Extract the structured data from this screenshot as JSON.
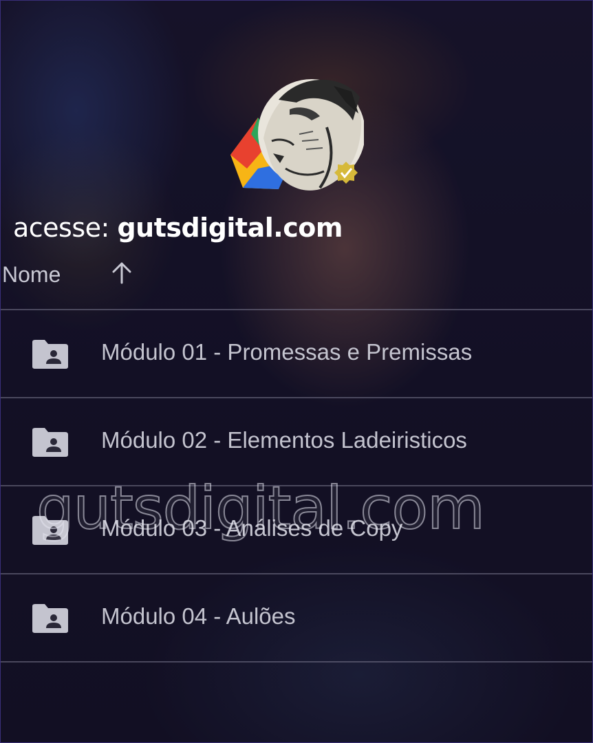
{
  "branding": {
    "tagline_prefix": "acesse:",
    "tagline_domain": "gutsdigital.com",
    "watermark": "gutsdigital.com",
    "logo_icon": "gutsdigital-logo-icon",
    "colors": {
      "red": "#e8412f",
      "yellow": "#f7b515",
      "green": "#2ea55a",
      "blue": "#2f6fe0",
      "badge": "#d6b93a"
    }
  },
  "file_list": {
    "header": {
      "name_label": "Nome",
      "sort_icon": "arrow-up-icon"
    },
    "rows": [
      {
        "icon": "shared-folder-icon",
        "label": "Módulo 01 - Promessas e Premissas"
      },
      {
        "icon": "shared-folder-icon",
        "label": "Módulo 02 - Elementos Ladeiristicos"
      },
      {
        "icon": "shared-folder-icon",
        "label": "Módulo 03 - Análises de Copy"
      },
      {
        "icon": "shared-folder-icon",
        "label": "Módulo 04 - Aulões"
      }
    ]
  }
}
